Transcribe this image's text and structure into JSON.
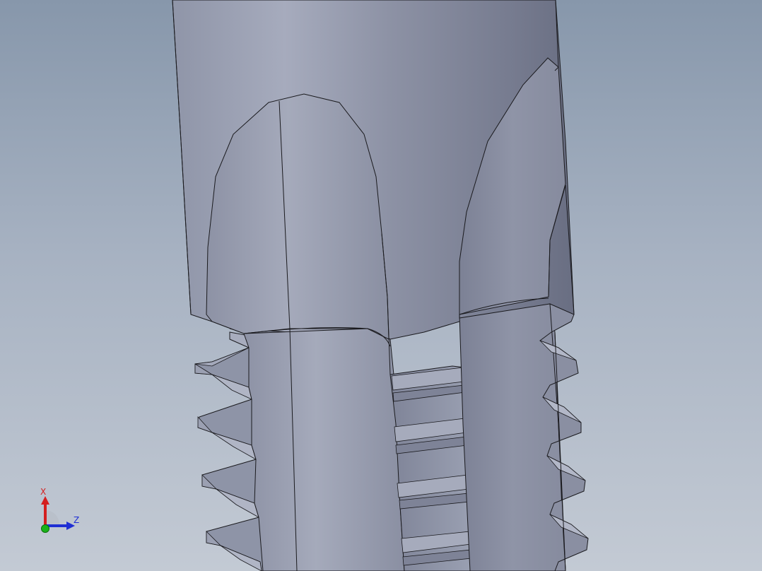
{
  "triad": {
    "x_label": "X",
    "z_label": "Z",
    "x_color": "#d41f1f",
    "y_color": "#19b319",
    "z_color": "#1f2fd4"
  },
  "model": {
    "body_color": "#8d93a6",
    "highlight_color": "#a3a9bb",
    "shadow_color": "#6e7386",
    "thread_face_color": "#9ea4b5",
    "edge_color": "#1a1a1e"
  }
}
